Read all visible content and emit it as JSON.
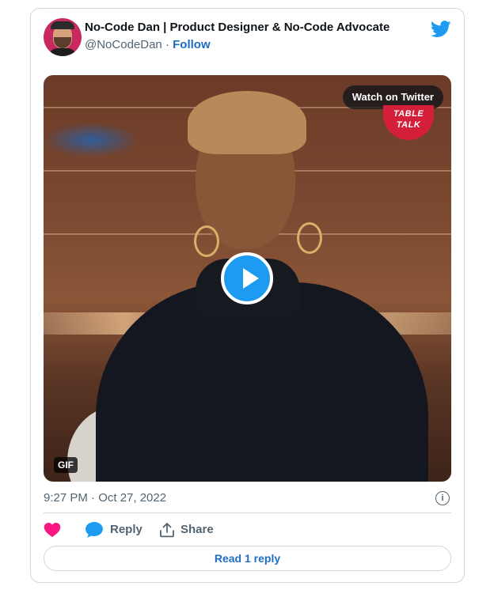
{
  "author": {
    "display_name": "No-Code Dan | Product Designer & No-Code Advocate",
    "handle": "@NoCodeDan",
    "separator": "·",
    "follow_label": "Follow"
  },
  "media": {
    "watch_label": "Watch on Twitter",
    "badge_line1": "TABLE",
    "badge_line2": "TALK",
    "gif_label": "GIF"
  },
  "tweet": {
    "timestamp": "9:27 PM · Oct 27, 2022",
    "info_glyph": "i"
  },
  "actions": {
    "reply_label": "Reply",
    "share_label": "Share"
  },
  "footer": {
    "read_replies_label": "Read 1 reply"
  },
  "colors": {
    "twitter_blue": "#1d9bf0",
    "like_pink": "#f91880",
    "link_blue": "#1d6dc3",
    "muted": "#536471",
    "border": "#cfd9de"
  }
}
